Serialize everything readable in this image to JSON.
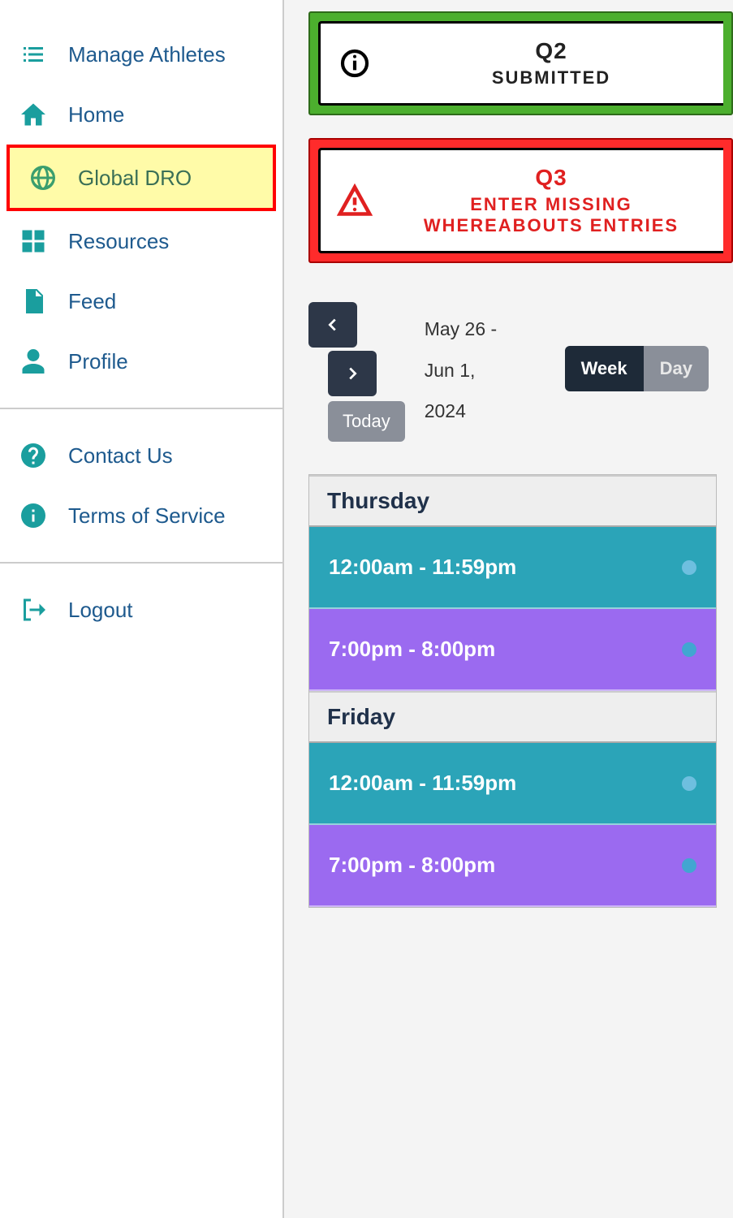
{
  "sidebar": {
    "items": [
      {
        "label": "Manage Athletes",
        "icon": "list"
      },
      {
        "label": "Home",
        "icon": "home"
      },
      {
        "label": "Global DRO",
        "icon": "globe",
        "highlight": true
      },
      {
        "label": "Resources",
        "icon": "grid"
      },
      {
        "label": "Feed",
        "icon": "doc"
      },
      {
        "label": "Profile",
        "icon": "person"
      },
      {
        "label": "Contact Us",
        "icon": "help"
      },
      {
        "label": "Terms of Service",
        "icon": "info"
      },
      {
        "label": "Logout",
        "icon": "logout"
      }
    ]
  },
  "status": {
    "q2": {
      "title": "Q2",
      "sub": "SUBMITTED"
    },
    "q3": {
      "title": "Q3",
      "sub": "ENTER MISSING WHEREABOUTS ENTRIES"
    }
  },
  "calendar": {
    "range_line1": "May 26 -",
    "range_line2": "Jun 1,",
    "range_line3": "2024",
    "today": "Today",
    "view_week": "Week",
    "view_day": "Day"
  },
  "schedule": [
    {
      "day": "Thursday",
      "events": [
        {
          "time": "12:00am - 11:59pm",
          "color": "teal"
        },
        {
          "time": "7:00pm - 8:00pm",
          "color": "purple"
        }
      ]
    },
    {
      "day": "Friday",
      "events": [
        {
          "time": "12:00am - 11:59pm",
          "color": "teal"
        },
        {
          "time": "7:00pm - 8:00pm",
          "color": "purple"
        }
      ]
    }
  ]
}
